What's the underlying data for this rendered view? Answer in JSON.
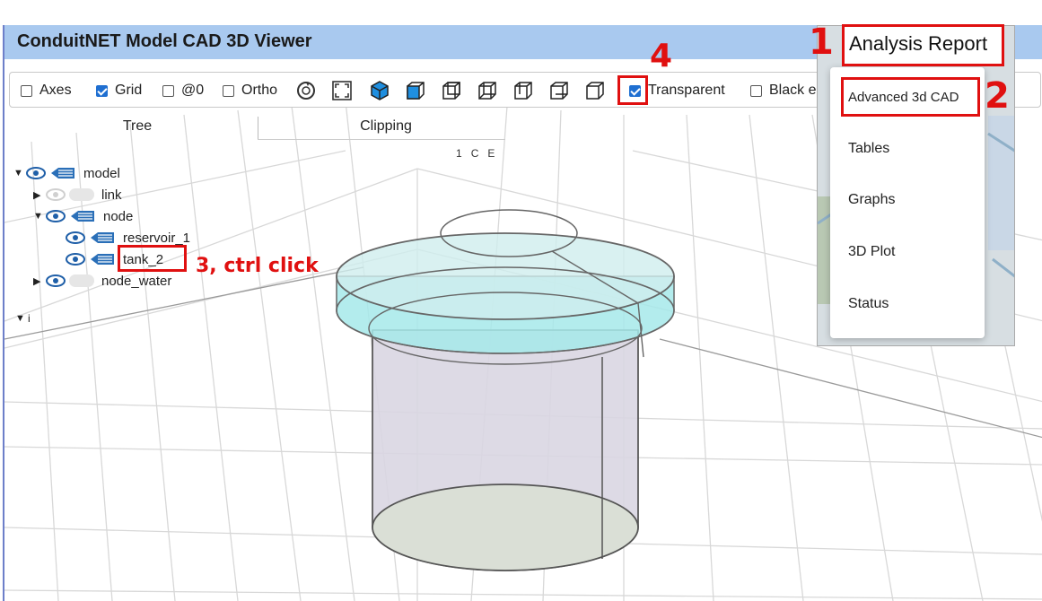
{
  "title": "ConduitNET Model CAD 3D Viewer",
  "toolbar": {
    "axes": {
      "label": "Axes",
      "checked": false
    },
    "grid": {
      "label": "Grid",
      "checked": true
    },
    "at0": {
      "label": "@0",
      "checked": false
    },
    "ortho": {
      "label": "Ortho",
      "checked": false
    },
    "transparent": {
      "label": "Transparent",
      "checked": true
    },
    "black_edges": {
      "label": "Black e",
      "checked": false
    },
    "icons": [
      "reset-view-icon",
      "fit-view-icon",
      "iso-view-icon",
      "front-view-icon",
      "back-view-icon",
      "left-view-icon",
      "right-view-icon",
      "top-view-icon",
      "bottom-view-icon",
      "bottom-alt-view-icon"
    ]
  },
  "tabs": {
    "tree": "Tree",
    "clipping": "Clipping"
  },
  "clip_header": {
    "a": "1",
    "b": "C",
    "c": "E"
  },
  "tree": [
    {
      "label": "model",
      "caret": "▼"
    },
    {
      "label": "link",
      "caret": "▶"
    },
    {
      "label": "node",
      "caret": "▼"
    },
    {
      "label": "reservoir_1",
      "caret": ""
    },
    {
      "label": "tank_2",
      "caret": ""
    },
    {
      "label": "node_water",
      "caret": "▶"
    },
    {
      "label": "i",
      "caret": "▼"
    }
  ],
  "menu": {
    "header": "Analysis Report",
    "items": [
      "Advanced 3d CAD",
      "Tables",
      "Graphs",
      "3D Plot",
      "Status"
    ]
  },
  "annotations": {
    "step1": "1",
    "step2": "2",
    "step3": "3, ctrl click",
    "step4": "4"
  },
  "colors": {
    "titlebar": "#a9c9ef",
    "annotation": "#e01010",
    "checkbox": "#1f6fd1",
    "tank_top": "#a6e9ea",
    "tank_body": "#d9d6e2"
  }
}
